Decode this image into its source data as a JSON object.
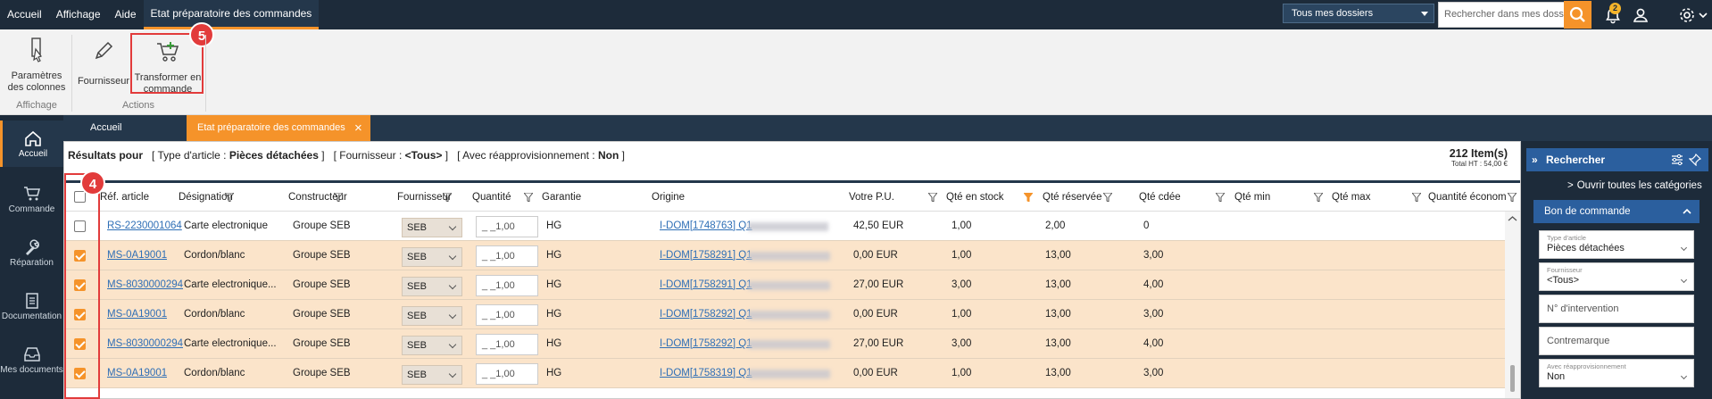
{
  "menu": [
    "Accueil",
    "Affichage",
    "Aide",
    "Etat préparatoire des commandes"
  ],
  "top": {
    "dossier": "Tous mes dossiers",
    "search_placeholder": "Rechercher dans mes dossiers",
    "notif_count": "2"
  },
  "ribbon": {
    "btn_cols": "Paramètres des colonnes",
    "group_affichage": "Affichage",
    "btn_fournisseur": "Fournisseur",
    "btn_transformer": "Transformer en commande",
    "group_actions": "Actions",
    "marker5": "5",
    "marker4": "4"
  },
  "nav": [
    "Accueil",
    "Commande",
    "Réparation",
    "Documentation",
    "Mes documents"
  ],
  "tabs": {
    "home": "Accueil",
    "active": "Etat préparatoire des commandes"
  },
  "results": {
    "label": "Résultats pour",
    "c1": "[ Type d'article : ",
    "c1v": "Pièces détachées",
    "c1e": " ]",
    "c2": "[ Fournisseur : ",
    "c2v": "<Tous>",
    "c2e": " ]",
    "c3": "[ Avec réapprovisionnement : ",
    "c3v": "Non",
    "c3e": " ]",
    "count": "212 Item(s)",
    "total": "Total HT : 54,00 €"
  },
  "columns": [
    "Réf. article",
    "Désignation",
    "Constructeur",
    "Fournisseur",
    "Quantité",
    "Garantie",
    "Origine",
    "Votre P.U.",
    "Qté en stock",
    "Qté réservée",
    "Qté cdée",
    "Qté min",
    "Qté max",
    "Quantité économ"
  ],
  "rows": [
    {
      "sel": false,
      "ref": "RS-2230001064",
      "des": "Carte electronique",
      "cons": "Groupe SEB",
      "four": "SEB",
      "qty": "_ _1,00",
      "gar": "HG",
      "orig": "I-DOM[1748763] Q1",
      "pu": "42,50 EUR",
      "stock": "1,00",
      "res": "2,00",
      "cdee": "0"
    },
    {
      "sel": true,
      "ref": "MS-0A19001",
      "des": "Cordon/blanc",
      "cons": "Groupe SEB",
      "four": "SEB",
      "qty": "_ _1,00",
      "gar": "HG",
      "orig": "I-DOM[1758291] Q1",
      "pu": "0,00 EUR",
      "stock": "1,00",
      "res": "13,00",
      "cdee": "3,00"
    },
    {
      "sel": true,
      "ref": "MS-8030000294",
      "des": "Carte electronique...",
      "cons": "Groupe SEB",
      "four": "SEB",
      "qty": "_ _1,00",
      "gar": "HG",
      "orig": "I-DOM[1758291] Q1",
      "pu": "27,00 EUR",
      "stock": "3,00",
      "res": "13,00",
      "cdee": "4,00"
    },
    {
      "sel": true,
      "ref": "MS-0A19001",
      "des": "Cordon/blanc",
      "cons": "Groupe SEB",
      "four": "SEB",
      "qty": "_ _1,00",
      "gar": "HG",
      "orig": "I-DOM[1758292] Q1",
      "pu": "0,00 EUR",
      "stock": "1,00",
      "res": "13,00",
      "cdee": "3,00"
    },
    {
      "sel": true,
      "ref": "MS-8030000294",
      "des": "Carte electronique...",
      "cons": "Groupe SEB",
      "four": "SEB",
      "qty": "_ _1,00",
      "gar": "HG",
      "orig": "I-DOM[1758292] Q1",
      "pu": "27,00 EUR",
      "stock": "3,00",
      "res": "13,00",
      "cdee": "4,00"
    },
    {
      "sel": true,
      "ref": "MS-0A19001",
      "des": "Cordon/blanc",
      "cons": "Groupe SEB",
      "four": "SEB",
      "qty": "_ _1,00",
      "gar": "HG",
      "orig": "I-DOM[1758319] Q1",
      "pu": "0,00 EUR",
      "stock": "1,00",
      "res": "13,00",
      "cdee": "3,00"
    }
  ],
  "panel": {
    "title": "Rechercher",
    "open_all": "Ouvrir toutes les catégories",
    "section": "Bon de commande",
    "f1_lbl": "Type d'article",
    "f1_val": "Pièces détachées",
    "f2_lbl": "Fournisseur",
    "f2_val": "<Tous>",
    "f3_ph": "N° d'intervention",
    "f4_ph": "Contremarque",
    "f5_lbl": "Avec réapprovisionnement",
    "f5_val": "Non"
  },
  "colors": {
    "accent": "#f5932a",
    "navy": "#1d2b3a",
    "highlight": "#e23b3b",
    "selected_row": "#fbe4ca"
  }
}
